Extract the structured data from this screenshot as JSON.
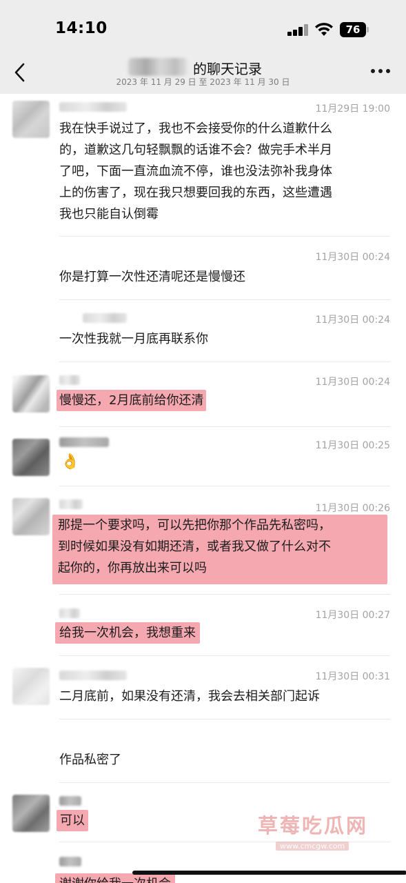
{
  "status_bar": {
    "time": "14:10",
    "battery": "76"
  },
  "header": {
    "back_icon": "chevron-left-icon",
    "title": "的聊天记录",
    "subtitle": "2023 年 11 月 29 日 至 2023 年 11 月 30 日",
    "more_icon": "ellipsis-icon"
  },
  "messages": [
    {
      "timestamp": "11月29日 19:00",
      "lines": [
        "我在快手说过了，我也不会接受你的什么道歉什么",
        "的，道歉这几句轻飘飘的话谁不会？做完手术半月",
        "了吧，下面一直流血流不停，谁也没法弥补我身体",
        "上的伤害了，现在我只想要回我的东西，这些遭遇",
        "我也只能自认倒霉"
      ]
    },
    {
      "timestamp": "11月30日 00:24",
      "text": "你是打算一次性还清呢还是慢慢还"
    },
    {
      "timestamp": "11月30日 00:24",
      "text": "一次性我就一月底再联系你"
    },
    {
      "timestamp": "11月30日 00:24",
      "text": "慢慢还，2月底前给你还清"
    },
    {
      "timestamp": "11月30日 00:25",
      "emoji": "👌"
    },
    {
      "timestamp": "11月30日 00:26",
      "lines": [
        "那提一个要求吗，可以先把你那个作品先私密吗，",
        "到时候如果没有如期还清，或者我又做了什么对不",
        "起你的，你再放出来可以吗"
      ]
    },
    {
      "timestamp": "11月30日 00:27",
      "text": "给我一次机会，我想重来"
    },
    {
      "timestamp": "11月30日 00:31",
      "text": "二月底前，如果没有还清，我会去相关部门起诉"
    },
    {
      "text": "作品私密了"
    },
    {
      "text": "可以"
    },
    {
      "text": "谢谢你给我一次机会"
    }
  ],
  "watermark": {
    "main": "草莓吃瓜网",
    "sub": "www.cmcgw.com"
  },
  "colors": {
    "highlight": "#f5a8b0",
    "header_bg": "#ededed",
    "timestamp": "#a3a3a3"
  }
}
